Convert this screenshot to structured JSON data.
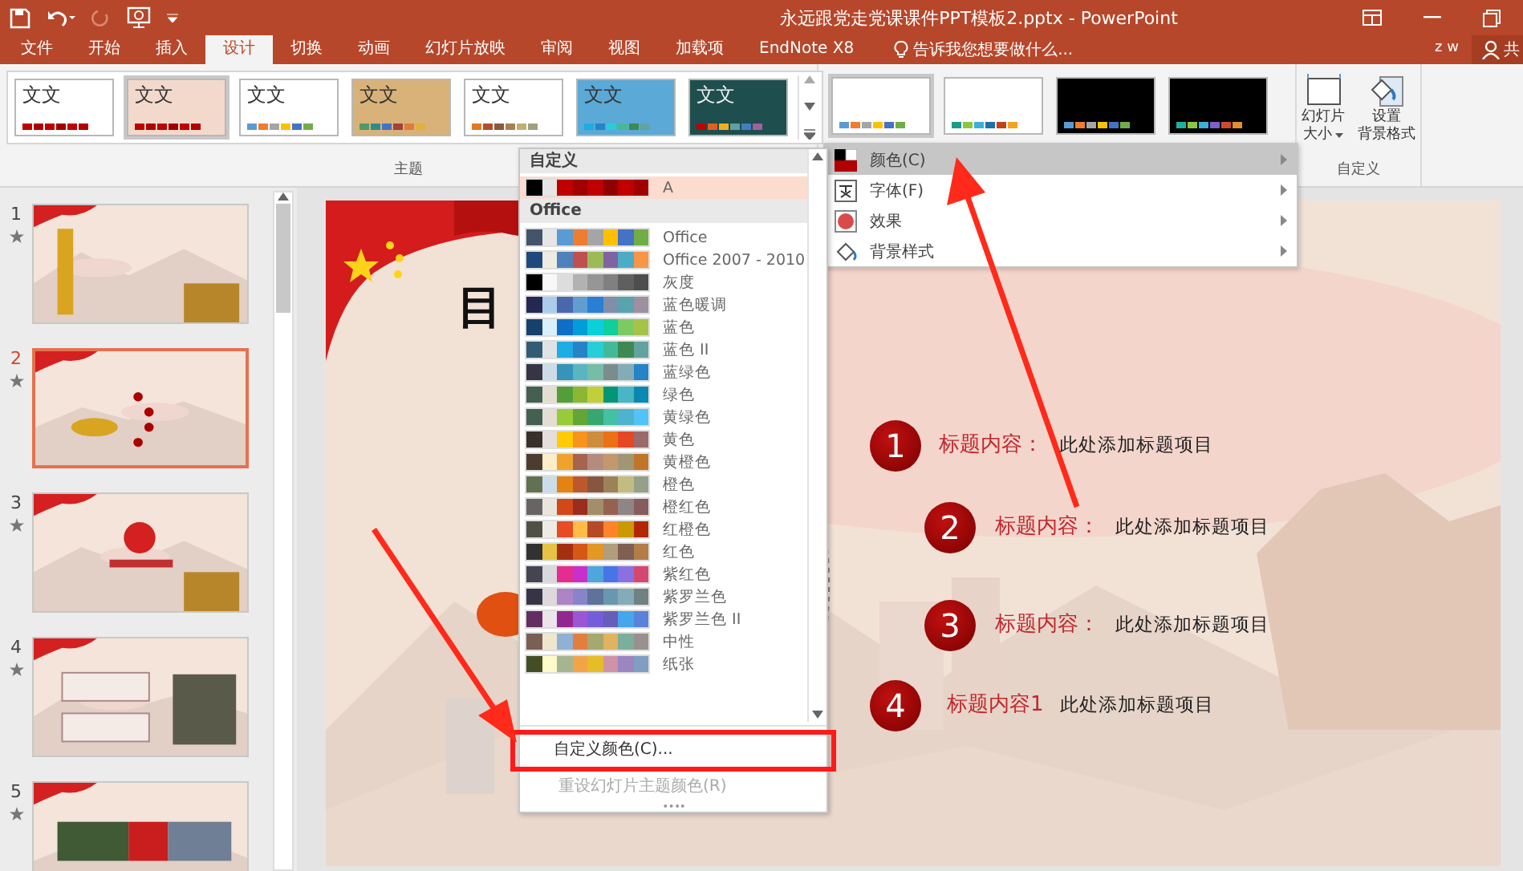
{
  "title_bar": {
    "title": "永远跟党走党课课件PPT模板2.pptx - PowerPoint",
    "user": "z w",
    "share": "共"
  },
  "tabs": [
    {
      "label": "文件",
      "selected": false
    },
    {
      "label": "开始",
      "selected": false
    },
    {
      "label": "插入",
      "selected": false
    },
    {
      "label": "设计",
      "selected": true
    },
    {
      "label": "切换",
      "selected": false
    },
    {
      "label": "动画",
      "selected": false
    },
    {
      "label": "幻灯片放映",
      "selected": false
    },
    {
      "label": "审阅",
      "selected": false
    },
    {
      "label": "视图",
      "selected": false
    },
    {
      "label": "加载项",
      "selected": false
    },
    {
      "label": "EndNote X8",
      "selected": false
    }
  ],
  "tell_me": {
    "placeholder": "告诉我您想要做什么..."
  },
  "themes": {
    "label": "主题",
    "items": [
      {
        "sample": "文文",
        "selected": false,
        "kind": "plain",
        "swatches": [
          {
            "color": "#c00000"
          },
          {
            "color": "#b00000"
          },
          {
            "color": "#c00000"
          },
          {
            "color": "#a00000"
          },
          {
            "color": "#c00000"
          },
          {
            "color": "#b00000"
          }
        ]
      },
      {
        "sample": "文文",
        "selected": true,
        "kind": "pink",
        "swatches": [
          {
            "color": "#c00000"
          },
          {
            "color": "#b00000"
          },
          {
            "color": "#c00000"
          },
          {
            "color": "#a00000"
          },
          {
            "color": "#c00000"
          },
          {
            "color": "#b00000"
          }
        ]
      },
      {
        "sample": "文文",
        "selected": false,
        "kind": "plain",
        "swatches": [
          {
            "color": "#5b9bd5"
          },
          {
            "color": "#ed7d31"
          },
          {
            "color": "#a5a5a5"
          },
          {
            "color": "#ffc000"
          },
          {
            "color": "#4472c4"
          },
          {
            "color": "#70ad47"
          }
        ]
      },
      {
        "sample": "文文",
        "selected": false,
        "kind": "wood",
        "swatches": [
          {
            "color": "#4e9a6a"
          },
          {
            "color": "#2e8b8b"
          },
          {
            "color": "#4472c4"
          },
          {
            "color": "#a0413c"
          },
          {
            "color": "#e07b39"
          },
          {
            "color": "#e0b040"
          }
        ]
      },
      {
        "sample": "文文",
        "selected": false,
        "kind": "plain",
        "swatches": [
          {
            "color": "#e07b1f"
          },
          {
            "color": "#b0502a"
          },
          {
            "color": "#8a5a3a"
          },
          {
            "color": "#a88050"
          },
          {
            "color": "#c0b070"
          },
          {
            "color": "#a0a080"
          }
        ]
      },
      {
        "sample": "文文",
        "selected": false,
        "kind": "pattern",
        "swatches": [
          {
            "color": "#1cade4"
          },
          {
            "color": "#2683c6"
          },
          {
            "color": "#27ced7"
          },
          {
            "color": "#42ba97"
          },
          {
            "color": "#3e8853"
          },
          {
            "color": "#62a39f"
          }
        ]
      },
      {
        "sample": "文文",
        "selected": false,
        "kind": "dark",
        "swatches": [
          {
            "color": "#c00000"
          },
          {
            "color": "#e06020"
          },
          {
            "color": "#f0b020"
          },
          {
            "color": "#60a0a0"
          },
          {
            "color": "#4080c0"
          },
          {
            "color": "#a060a0"
          }
        ]
      }
    ]
  },
  "variants": [
    {
      "selected": true,
      "kind": "light",
      "swatches": [
        {
          "color": "#5b9bd5"
        },
        {
          "color": "#ed7d31"
        },
        {
          "color": "#a5a5a5"
        },
        {
          "color": "#ffc000"
        },
        {
          "color": "#4472c4"
        },
        {
          "color": "#70ad47"
        }
      ]
    },
    {
      "selected": false,
      "kind": "light",
      "swatches": [
        {
          "color": "#1a9c86"
        },
        {
          "color": "#8cc63f"
        },
        {
          "color": "#3bb0d8"
        },
        {
          "color": "#1f6fa8"
        },
        {
          "color": "#c2431a"
        },
        {
          "color": "#f4a41c"
        }
      ]
    },
    {
      "selected": false,
      "kind": "dark",
      "swatches": [
        {
          "color": "#5b9bd5"
        },
        {
          "color": "#ed7d31"
        },
        {
          "color": "#a5a5a5"
        },
        {
          "color": "#ffc000"
        },
        {
          "color": "#4472c4"
        },
        {
          "color": "#70ad47"
        }
      ]
    },
    {
      "selected": false,
      "kind": "dark",
      "swatches": [
        {
          "color": "#1ab39f"
        },
        {
          "color": "#8cc63f"
        },
        {
          "color": "#3bb0d8"
        },
        {
          "color": "#7f5fc8"
        },
        {
          "color": "#d04a2a"
        },
        {
          "color": "#e09030"
        }
      ]
    }
  ],
  "customize": {
    "label": "自定义",
    "buttons": [
      {
        "kind": "size",
        "lines": [
          "幻灯片",
          "大小"
        ]
      },
      {
        "kind": "background",
        "lines": [
          "设置",
          "背景格式"
        ]
      }
    ]
  },
  "variant_menu": [
    {
      "kind": "colors",
      "label": "颜色(C)",
      "selected": true
    },
    {
      "kind": "fonts",
      "label": "字体(F)",
      "selected": false
    },
    {
      "kind": "effects",
      "label": "效果",
      "selected": false
    },
    {
      "kind": "background",
      "label": "背景样式",
      "selected": false
    }
  ],
  "color_menu": {
    "sections": [
      {
        "title": "自定义",
        "items": [
          {
            "name": "A",
            "selected": true,
            "swatches": [
              {
                "color": "#000000"
              },
              {
                "color": "#e7e6e6"
              },
              {
                "color": "#c00000"
              },
              {
                "color": "#a00000"
              },
              {
                "color": "#c00000"
              },
              {
                "color": "#900000"
              },
              {
                "color": "#c00000"
              },
              {
                "color": "#a00000"
              }
            ]
          }
        ]
      },
      {
        "title": "Office",
        "items": [
          {
            "name": "Office",
            "selected": false,
            "swatches": [
              {
                "color": "#44546a"
              },
              {
                "color": "#e7e6e6"
              },
              {
                "color": "#5b9bd5"
              },
              {
                "color": "#ed7d31"
              },
              {
                "color": "#a5a5a5"
              },
              {
                "color": "#ffc000"
              },
              {
                "color": "#4472c4"
              },
              {
                "color": "#70ad47"
              }
            ]
          },
          {
            "name": "Office 2007 - 2010",
            "selected": false,
            "swatches": [
              {
                "color": "#1f497d"
              },
              {
                "color": "#eeece1"
              },
              {
                "color": "#4f81bd"
              },
              {
                "color": "#c0504d"
              },
              {
                "color": "#9bbb59"
              },
              {
                "color": "#8064a2"
              },
              {
                "color": "#4bacc6"
              },
              {
                "color": "#f79646"
              }
            ]
          },
          {
            "name": "灰度",
            "selected": false,
            "swatches": [
              {
                "color": "#000000"
              },
              {
                "color": "#f8f8f8"
              },
              {
                "color": "#dddddd"
              },
              {
                "color": "#b2b2b2"
              },
              {
                "color": "#969696"
              },
              {
                "color": "#808080"
              },
              {
                "color": "#5f5f5f"
              },
              {
                "color": "#4d4d4d"
              }
            ]
          },
          {
            "name": "蓝色暖调",
            "selected": false,
            "swatches": [
              {
                "color": "#242852"
              },
              {
                "color": "#acccea"
              },
              {
                "color": "#4a66ac"
              },
              {
                "color": "#629dd1"
              },
              {
                "color": "#297fd5"
              },
              {
                "color": "#7f8fa9"
              },
              {
                "color": "#5aa2ae"
              },
              {
                "color": "#9d90a0"
              }
            ]
          },
          {
            "name": "蓝色",
            "selected": false,
            "swatches": [
              {
                "color": "#17406d"
              },
              {
                "color": "#dbeff9"
              },
              {
                "color": "#0f6fc6"
              },
              {
                "color": "#009dd9"
              },
              {
                "color": "#0bd0d9"
              },
              {
                "color": "#10cf9b"
              },
              {
                "color": "#7cca62"
              },
              {
                "color": "#a5c249"
              }
            ]
          },
          {
            "name": "蓝色 II",
            "selected": false,
            "swatches": [
              {
                "color": "#335b74"
              },
              {
                "color": "#dfe3e5"
              },
              {
                "color": "#1cade4"
              },
              {
                "color": "#2683c6"
              },
              {
                "color": "#27ced7"
              },
              {
                "color": "#42ba97"
              },
              {
                "color": "#3e8853"
              },
              {
                "color": "#62a39f"
              }
            ]
          },
          {
            "name": "蓝绿色",
            "selected": false,
            "swatches": [
              {
                "color": "#373545"
              },
              {
                "color": "#cedbe6"
              },
              {
                "color": "#3494ba"
              },
              {
                "color": "#58b6c0"
              },
              {
                "color": "#75bda7"
              },
              {
                "color": "#7a8c8e"
              },
              {
                "color": "#84acb6"
              },
              {
                "color": "#2683c6"
              }
            ]
          },
          {
            "name": "绿色",
            "selected": false,
            "swatches": [
              {
                "color": "#455f51"
              },
              {
                "color": "#e3ded1"
              },
              {
                "color": "#549e39"
              },
              {
                "color": "#8ab833"
              },
              {
                "color": "#c0cf3a"
              },
              {
                "color": "#029676"
              },
              {
                "color": "#4ab5c4"
              },
              {
                "color": "#0989b1"
              }
            ]
          },
          {
            "name": "黄绿色",
            "selected": false,
            "swatches": [
              {
                "color": "#455f51"
              },
              {
                "color": "#e3ded1"
              },
              {
                "color": "#99cb38"
              },
              {
                "color": "#63a537"
              },
              {
                "color": "#37a76f"
              },
              {
                "color": "#44c1a3"
              },
              {
                "color": "#4eb3cf"
              },
              {
                "color": "#51c3f9"
              }
            ]
          },
          {
            "name": "黄色",
            "selected": false,
            "swatches": [
              {
                "color": "#39302a"
              },
              {
                "color": "#e5dedb"
              },
              {
                "color": "#ffca08"
              },
              {
                "color": "#f8931d"
              },
              {
                "color": "#ce8d3e"
              },
              {
                "color": "#ec7016"
              },
              {
                "color": "#e64823"
              },
              {
                "color": "#9c6a6a"
              }
            ]
          },
          {
            "name": "黄橙色",
            "selected": false,
            "swatches": [
              {
                "color": "#4e3b30"
              },
              {
                "color": "#fbeec9"
              },
              {
                "color": "#f0a22e"
              },
              {
                "color": "#a5644e"
              },
              {
                "color": "#b58b80"
              },
              {
                "color": "#c3986d"
              },
              {
                "color": "#a19574"
              },
              {
                "color": "#c17529"
              }
            ]
          },
          {
            "name": "橙色",
            "selected": false,
            "swatches": [
              {
                "color": "#637052"
              },
              {
                "color": "#ccddea"
              },
              {
                "color": "#e48312"
              },
              {
                "color": "#bd582c"
              },
              {
                "color": "#865640"
              },
              {
                "color": "#9b8357"
              },
              {
                "color": "#c2bc80"
              },
              {
                "color": "#94a088"
              }
            ]
          },
          {
            "name": "橙红色",
            "selected": false,
            "swatches": [
              {
                "color": "#696464"
              },
              {
                "color": "#e9e5dc"
              },
              {
                "color": "#d34817"
              },
              {
                "color": "#9b2d1f"
              },
              {
                "color": "#a28e6a"
              },
              {
                "color": "#956251"
              },
              {
                "color": "#918485"
              },
              {
                "color": "#855d5d"
              }
            ]
          },
          {
            "name": "红橙色",
            "selected": false,
            "swatches": [
              {
                "color": "#505046"
              },
              {
                "color": "#eeece1"
              },
              {
                "color": "#e84c22"
              },
              {
                "color": "#ffbd47"
              },
              {
                "color": "#b64926"
              },
              {
                "color": "#ff8427"
              },
              {
                "color": "#cc9900"
              },
              {
                "color": "#b22600"
              }
            ]
          },
          {
            "name": "红色",
            "selected": false,
            "swatches": [
              {
                "color": "#323232"
              },
              {
                "color": "#e5c243"
              },
              {
                "color": "#a5300f"
              },
              {
                "color": "#d55816"
              },
              {
                "color": "#e19825"
              },
              {
                "color": "#b19c7d"
              },
              {
                "color": "#7f5f52"
              },
              {
                "color": "#b27d49"
              }
            ]
          },
          {
            "name": "紫红色",
            "selected": false,
            "swatches": [
              {
                "color": "#454551"
              },
              {
                "color": "#d8d9dc"
              },
              {
                "color": "#e32d91"
              },
              {
                "color": "#c830cc"
              },
              {
                "color": "#4ea6dc"
              },
              {
                "color": "#4775e7"
              },
              {
                "color": "#8971e1"
              },
              {
                "color": "#d54773"
              }
            ]
          },
          {
            "name": "紫罗兰色",
            "selected": false,
            "swatches": [
              {
                "color": "#373545"
              },
              {
                "color": "#dcd8dc"
              },
              {
                "color": "#ad84c6"
              },
              {
                "color": "#8784c7"
              },
              {
                "color": "#5d739a"
              },
              {
                "color": "#6997af"
              },
              {
                "color": "#84acb6"
              },
              {
                "color": "#6f8183"
              }
            ]
          },
          {
            "name": "紫罗兰色 II",
            "selected": false,
            "swatches": [
              {
                "color": "#632e62"
              },
              {
                "color": "#eae5eb"
              },
              {
                "color": "#92278f"
              },
              {
                "color": "#9b57d3"
              },
              {
                "color": "#755dd9"
              },
              {
                "color": "#665eb8"
              },
              {
                "color": "#45a5ed"
              },
              {
                "color": "#5982db"
              }
            ]
          },
          {
            "name": "中性",
            "selected": false,
            "swatches": [
              {
                "color": "#7a5f55"
              },
              {
                "color": "#efe6ce"
              },
              {
                "color": "#8fb2d4"
              },
              {
                "color": "#e37f3e"
              },
              {
                "color": "#a7a770"
              },
              {
                "color": "#e0b35f"
              },
              {
                "color": "#7bae9c"
              },
              {
                "color": "#9b9090"
              }
            ]
          },
          {
            "name": "纸张",
            "selected": false,
            "swatches": [
              {
                "color": "#444d26"
              },
              {
                "color": "#fefac9"
              },
              {
                "color": "#a5b592"
              },
              {
                "color": "#f3a447"
              },
              {
                "color": "#e7bc29"
              },
              {
                "color": "#d092a7"
              },
              {
                "color": "#9c85c0"
              },
              {
                "color": "#809ec2"
              }
            ]
          }
        ]
      }
    ],
    "commands": [
      {
        "label": "自定义颜色(C)...",
        "disabled": false
      },
      {
        "label": "重设幻灯片主题颜色(R)",
        "disabled": true
      }
    ]
  },
  "slides": [
    {
      "number": "1",
      "selected": false
    },
    {
      "number": "2",
      "selected": true
    },
    {
      "number": "3",
      "selected": false
    },
    {
      "number": "4",
      "selected": false
    },
    {
      "number": "5",
      "selected": false
    }
  ],
  "slide": {
    "title": "目",
    "items": [
      {
        "number": "1",
        "heading": "标题内容：",
        "text": "此处添加标题项目"
      },
      {
        "number": "2",
        "heading": "标题内容：",
        "text": "此处添加标题项目"
      },
      {
        "number": "3",
        "heading": "标题内容：",
        "text": "此处添加标题项目"
      },
      {
        "number": "4",
        "heading": "标题内容1",
        "text": "此处添加标题项目"
      }
    ]
  }
}
